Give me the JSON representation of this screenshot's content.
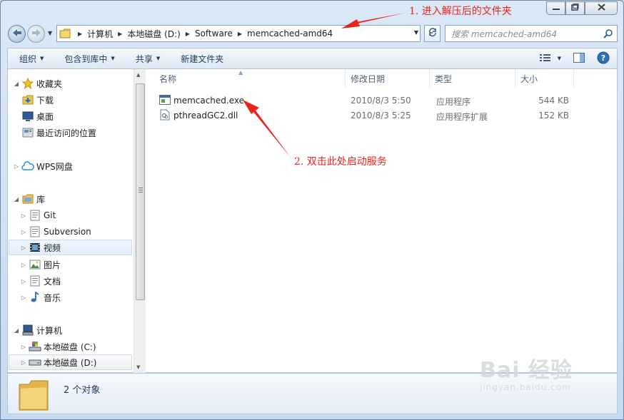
{
  "window": {
    "minimize_icon": "minimize-icon",
    "maximize_icon": "maximize-icon",
    "close_icon": "close-icon"
  },
  "address_bar": {
    "breadcrumbs": [
      "计算机",
      "本地磁盘 (D:)",
      "Software",
      "memcached-amd64"
    ]
  },
  "search": {
    "placeholder": "搜索 memcached-amd64"
  },
  "toolbar": {
    "organize": "组织",
    "include_in_library": "包含到库中",
    "share": "共享",
    "new_folder": "新建文件夹"
  },
  "nav_tree": {
    "favorites": "收藏夹",
    "downloads": "下载",
    "desktop": "桌面",
    "recent": "最近访问的位置",
    "wps": "WPS网盘",
    "libraries": "库",
    "git": "Git",
    "subversion": "Subversion",
    "videos": "视频",
    "pictures": "图片",
    "documents": "文档",
    "music": "音乐",
    "computer": "计算机",
    "drive_c": "本地磁盘 (C:)",
    "drive_d": "本地磁盘 (D:)"
  },
  "columns": {
    "name": "名称",
    "modified": "修改日期",
    "type": "类型",
    "size": "大小"
  },
  "files": [
    {
      "name": "memcached.exe",
      "modified": "2010/8/3 5:50",
      "type": "应用程序",
      "size": "544 KB",
      "icon": "exe-icon"
    },
    {
      "name": "pthreadGC2.dll",
      "modified": "2010/8/3 5:25",
      "type": "应用程序扩展",
      "size": "152 KB",
      "icon": "dll-icon"
    }
  ],
  "details": {
    "count_text": "2 个对象"
  },
  "annotations": {
    "step1": "1. 进入解压后的文件夹",
    "step2": "2. 双击此处启动服务",
    "color": "#e8241c"
  },
  "watermark": {
    "brand": "Bai 经验",
    "url": "jingyan.baidu.com"
  }
}
